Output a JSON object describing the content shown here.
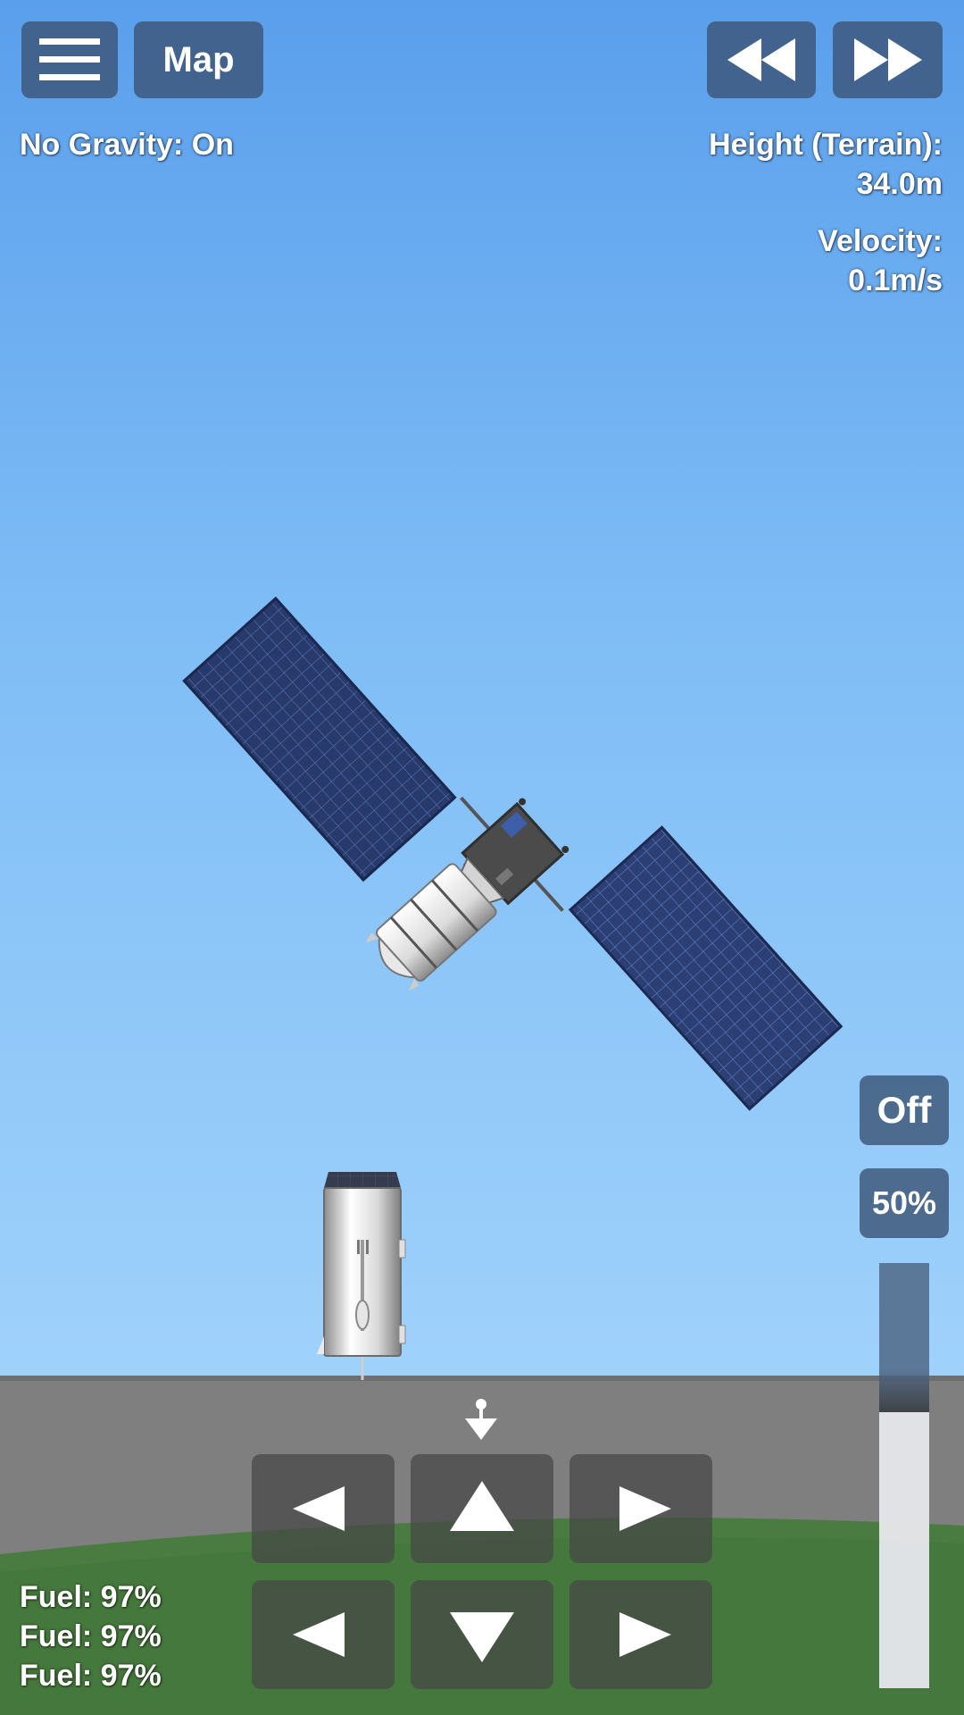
{
  "colors": {
    "sky_top": "#5a9fec",
    "sky_bottom": "#9fd0fb",
    "ground_gray": "#7f7f7f",
    "grass": "#4a7c41",
    "button_bg": "#3c5578"
  },
  "toolbar": {
    "menu_icon": "hamburger-icon",
    "map_label": "Map",
    "rewind_icon": "rewind-icon",
    "fast_forward_icon": "fast-forward-icon"
  },
  "status": {
    "no_gravity": "No Gravity: On",
    "height_label": "Height (Terrain):",
    "height_value": "34.0m",
    "velocity_label": "Velocity:",
    "velocity_value": "0.1m/s"
  },
  "throttle": {
    "toggle_label": "Off",
    "percent_label": "50%",
    "level": 0.65
  },
  "fuel": [
    "Fuel: 97%",
    "Fuel: 97%",
    "Fuel: 97%"
  ],
  "controls": {
    "top_row": [
      "rotate-left-icon",
      "thrust-up-icon",
      "rotate-right-icon"
    ],
    "bottom_row": [
      "translate-left-icon",
      "thrust-down-icon",
      "translate-right-icon"
    ]
  }
}
